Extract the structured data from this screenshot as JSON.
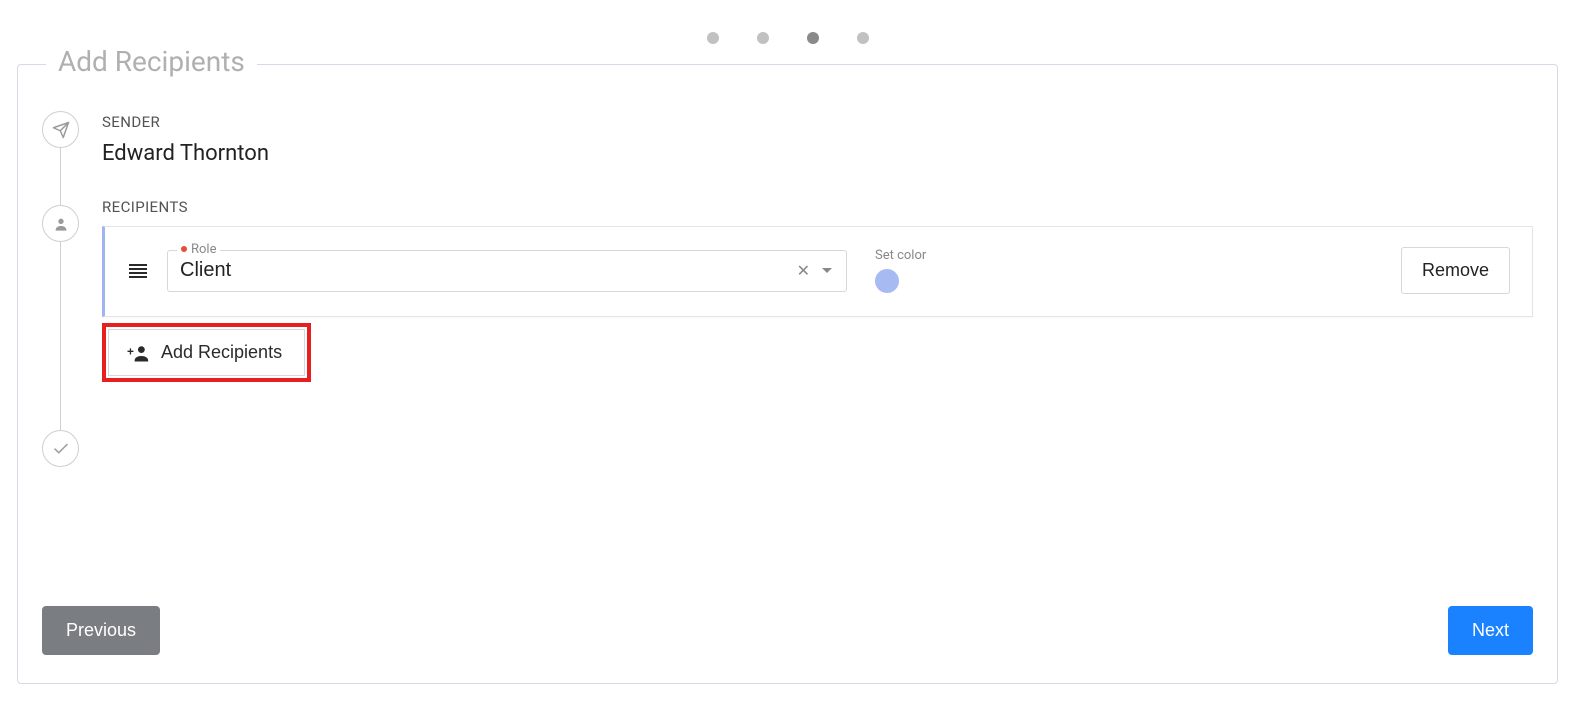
{
  "stepper": {
    "total": 4,
    "activeIndex": 2
  },
  "panel": {
    "title": "Add Recipients"
  },
  "sender": {
    "label": "SENDER",
    "name": "Edward Thornton"
  },
  "recipients": {
    "label": "RECIPIENTS",
    "items": [
      {
        "roleLabel": "Role",
        "roleValue": "Client",
        "setColorLabel": "Set color",
        "colorHex": "#a8baf2",
        "removeLabel": "Remove"
      }
    ],
    "addButtonLabel": "Add Recipients"
  },
  "footer": {
    "previousLabel": "Previous",
    "nextLabel": "Next"
  }
}
